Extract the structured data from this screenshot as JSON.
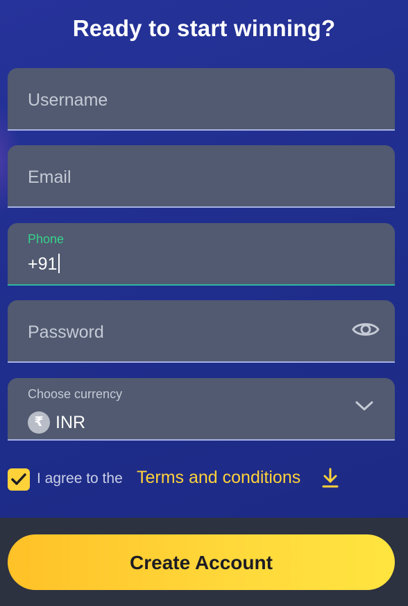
{
  "title": "Ready to start winning?",
  "fields": {
    "username": {
      "placeholder": "Username"
    },
    "email": {
      "placeholder": "Email"
    },
    "phone": {
      "label": "Phone",
      "value": "+91"
    },
    "password": {
      "placeholder": "Password",
      "toggle_icon": "eye-icon"
    },
    "currency": {
      "label": "Choose currency",
      "symbol": "₹",
      "code": "INR",
      "dropdown_icon": "chevron-down-icon"
    }
  },
  "agreement": {
    "checked": true,
    "text": "I agree to the",
    "link": "Terms and conditions",
    "link_icon": "download-icon"
  },
  "submit": {
    "label": "Create Account"
  },
  "colors": {
    "accent_yellow": "#ffd23a",
    "background_blue": "#1f2d8c",
    "field_bg": "#515a70",
    "active_underline": "#2fb7a0",
    "phone_label_green": "#35d28b"
  }
}
